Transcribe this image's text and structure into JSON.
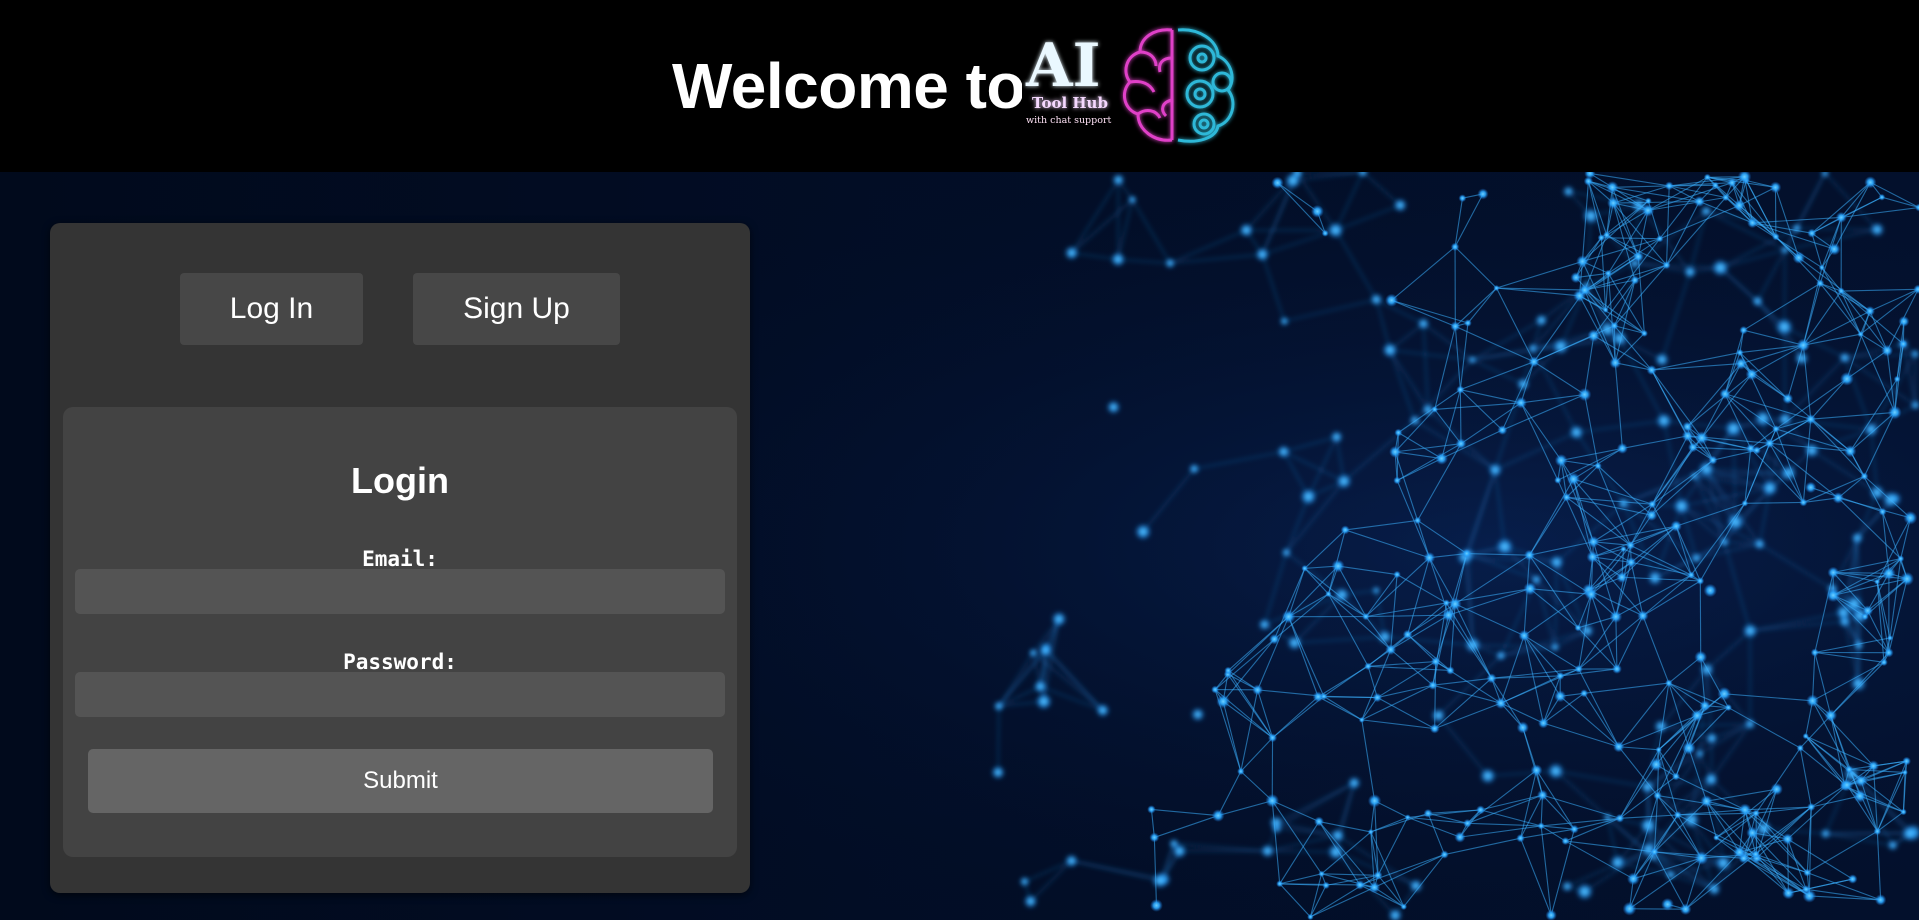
{
  "header": {
    "welcome_text": "Welcome to",
    "logo": {
      "main_text": "AI",
      "sub_text": "Tool Hub",
      "tagline": "with chat support",
      "icon": "brain-gears-icon",
      "colors": {
        "text_glow": "#bfe9ff",
        "brain": "#e040c8",
        "gears": "#2fb8d8"
      }
    }
  },
  "auth": {
    "tabs": [
      {
        "label": "Log In"
      },
      {
        "label": "Sign Up"
      }
    ],
    "form": {
      "title": "Login",
      "email_label": "Email:",
      "email_value": "",
      "password_label": "Password:",
      "password_value": "",
      "submit_label": "Submit"
    }
  },
  "theme": {
    "panel_bg": "#343434",
    "card_bg": "#434343",
    "input_bg": "#545454",
    "button_bg": "#656565",
    "network_color": "#2aa8ff"
  }
}
